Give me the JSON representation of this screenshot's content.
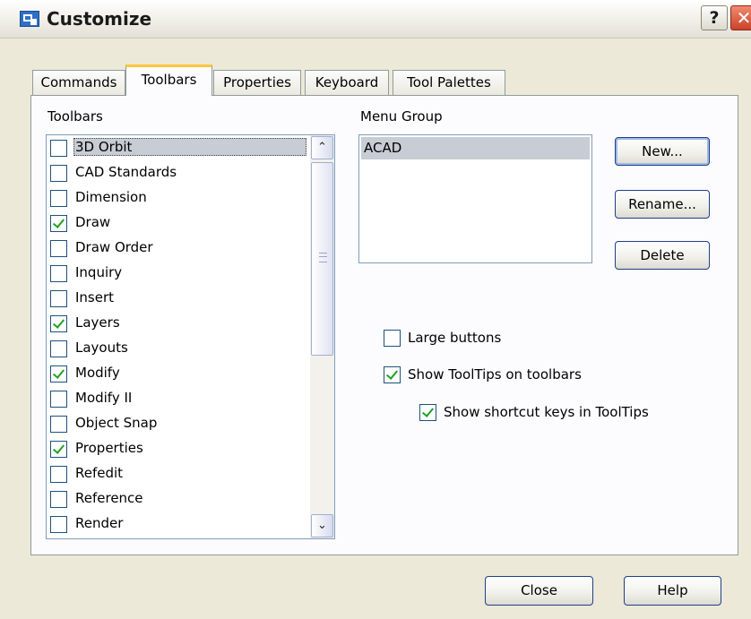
{
  "window": {
    "title": "Customize",
    "help_glyph": "?",
    "close_glyph": "✕"
  },
  "tabs": [
    {
      "label": "Commands",
      "active": false
    },
    {
      "label": "Toolbars",
      "active": true
    },
    {
      "label": "Properties",
      "active": false
    },
    {
      "label": "Keyboard",
      "active": false
    },
    {
      "label": "Tool Palettes",
      "active": false
    }
  ],
  "toolbars_section": {
    "label": "Toolbars",
    "items": [
      {
        "label": "3D Orbit",
        "checked": false,
        "selected": true
      },
      {
        "label": "CAD Standards",
        "checked": false,
        "selected": false
      },
      {
        "label": "Dimension",
        "checked": false,
        "selected": false
      },
      {
        "label": "Draw",
        "checked": true,
        "selected": false
      },
      {
        "label": "Draw Order",
        "checked": false,
        "selected": false
      },
      {
        "label": "Inquiry",
        "checked": false,
        "selected": false
      },
      {
        "label": "Insert",
        "checked": false,
        "selected": false
      },
      {
        "label": "Layers",
        "checked": true,
        "selected": false
      },
      {
        "label": "Layouts",
        "checked": false,
        "selected": false
      },
      {
        "label": "Modify",
        "checked": true,
        "selected": false
      },
      {
        "label": "Modify II",
        "checked": false,
        "selected": false
      },
      {
        "label": "Object Snap",
        "checked": false,
        "selected": false
      },
      {
        "label": "Properties",
        "checked": true,
        "selected": false
      },
      {
        "label": "Refedit",
        "checked": false,
        "selected": false
      },
      {
        "label": "Reference",
        "checked": false,
        "selected": false
      },
      {
        "label": "Render",
        "checked": false,
        "selected": false
      }
    ],
    "scroll_up_glyph": "⌃",
    "scroll_down_glyph": "⌄"
  },
  "menu_group": {
    "label": "Menu Group",
    "items": [
      "ACAD"
    ]
  },
  "side_buttons": {
    "new": "New...",
    "rename": "Rename...",
    "delete": "Delete"
  },
  "options": {
    "large_buttons": {
      "label": "Large buttons",
      "checked": false
    },
    "show_tooltips": {
      "label": "Show ToolTips on toolbars",
      "checked": true
    },
    "show_shortcut_keys": {
      "label": "Show shortcut keys in ToolTips",
      "checked": true
    }
  },
  "footer": {
    "close": "Close",
    "help": "Help"
  }
}
